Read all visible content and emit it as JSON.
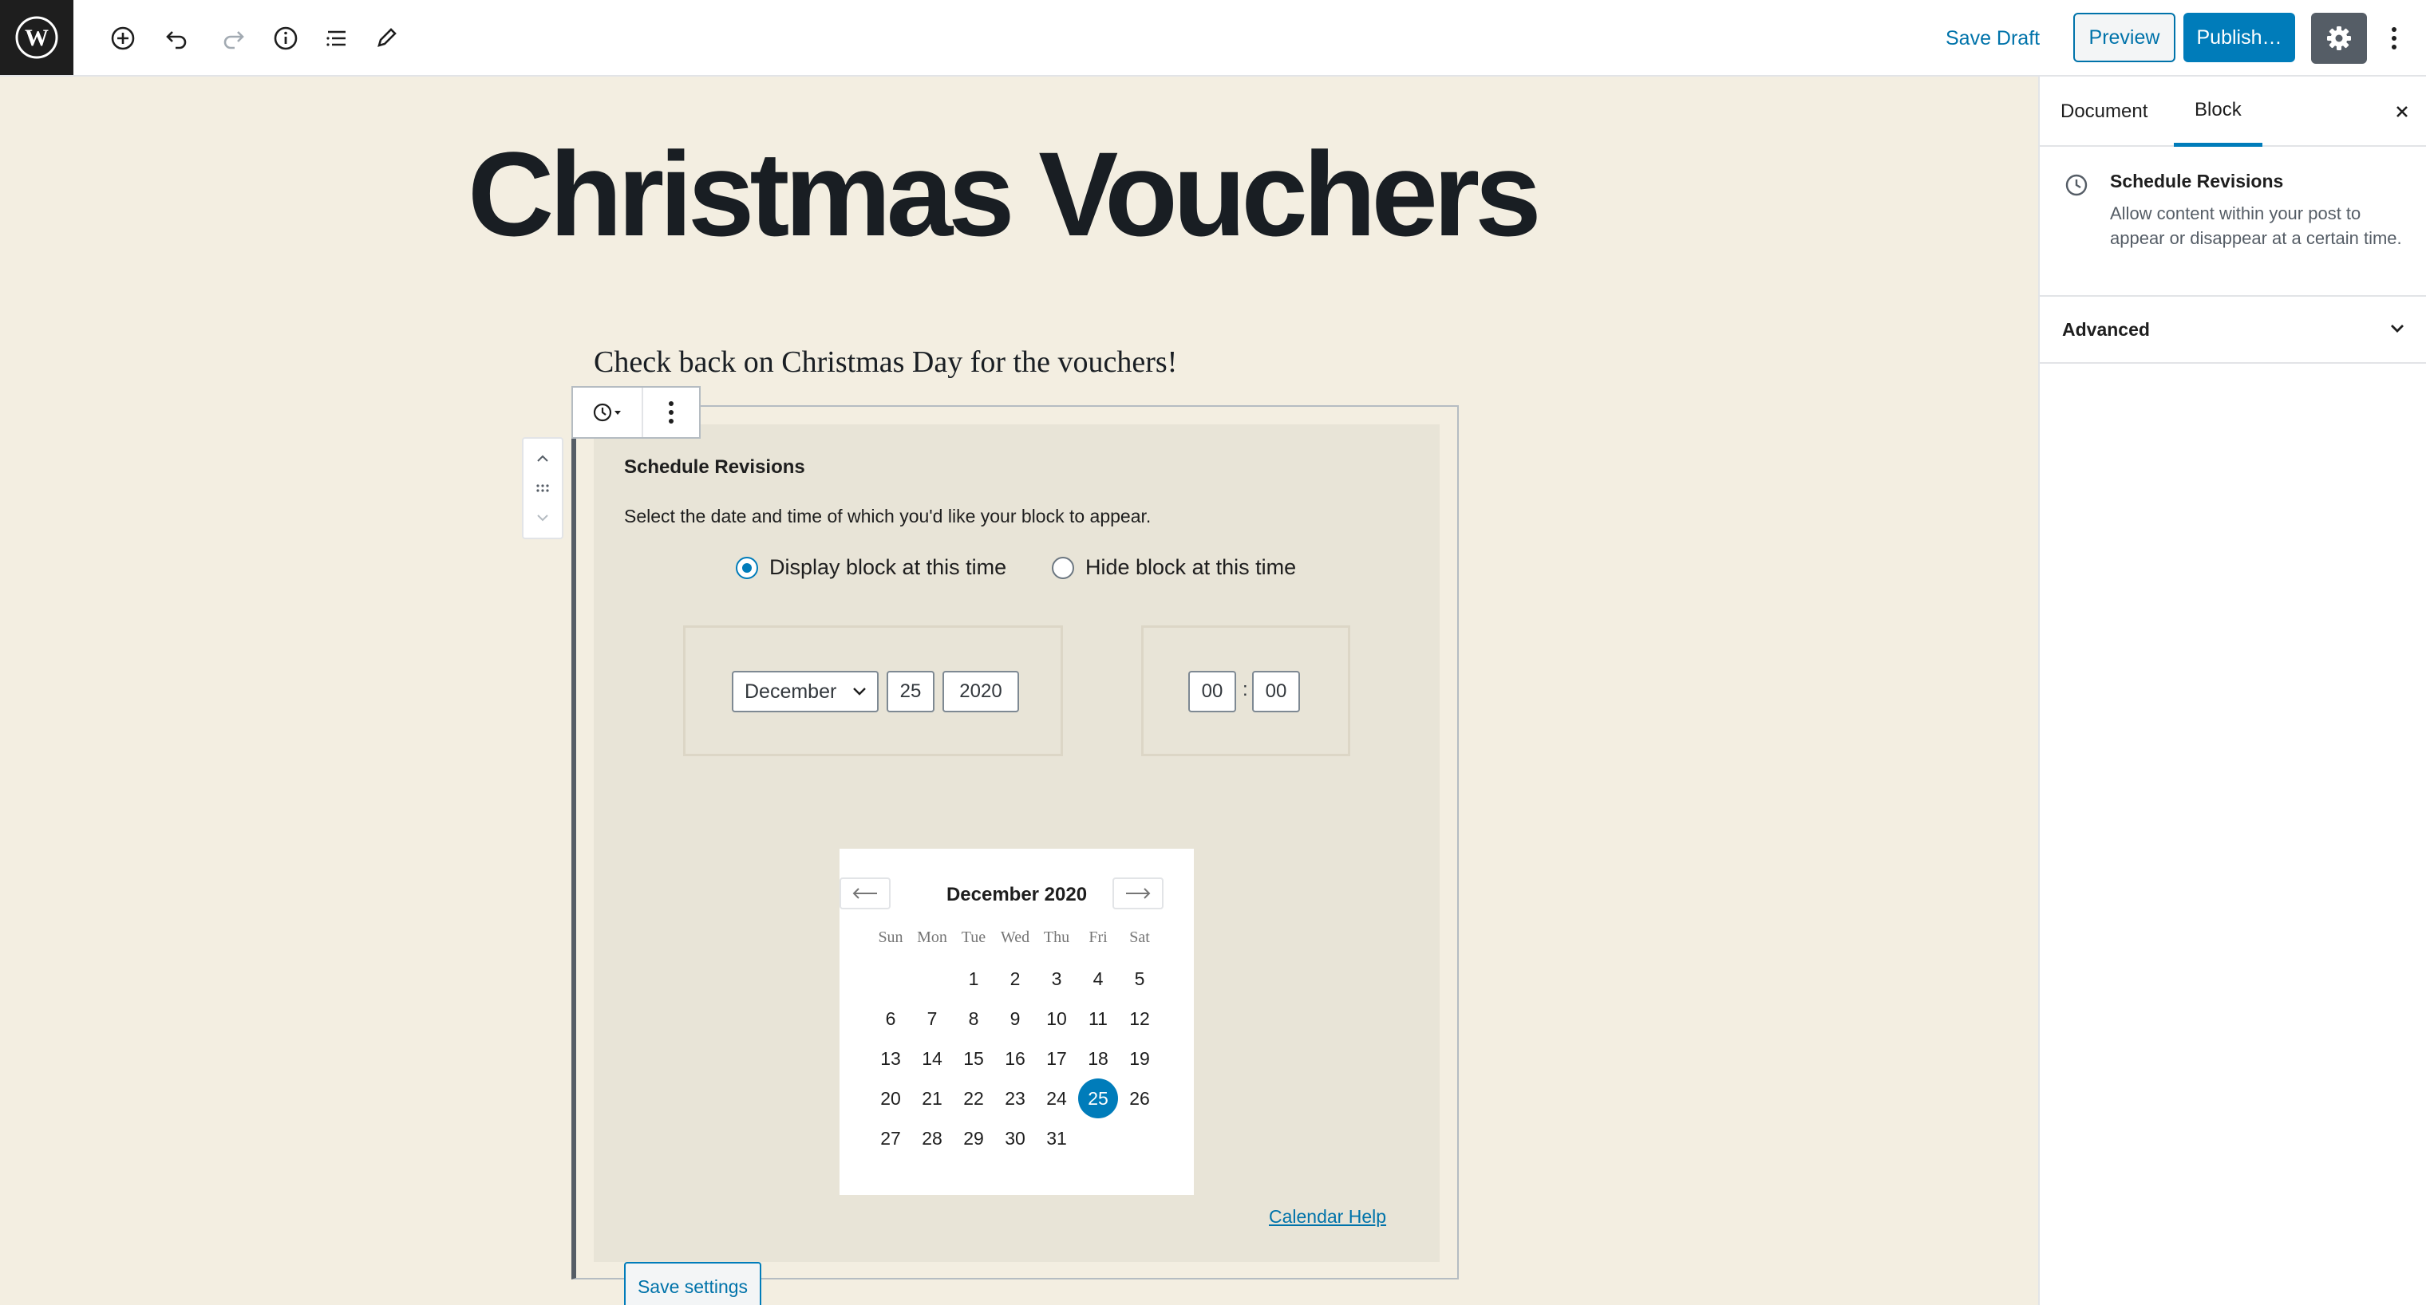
{
  "toolbar": {
    "save_draft": "Save Draft",
    "preview": "Preview",
    "publish": "Publish…",
    "icons": [
      "wordpress-logo-icon",
      "add-block-icon",
      "undo-icon",
      "redo-icon",
      "info-icon",
      "block-navigation-icon",
      "edit-mode-icon",
      "settings-gear-icon",
      "more-options-icon"
    ]
  },
  "post": {
    "title": "Christmas Vouchers",
    "paragraph": "Check back on Christmas Day for the vouchers!"
  },
  "block": {
    "title": "Schedule Revisions",
    "description": "Select the date and time of which you'd like your block to appear.",
    "radio_display": "Display block at this time",
    "radio_hide": "Hide block at this time",
    "selected_option": "display",
    "month": "December",
    "day": "25",
    "year": "2020",
    "hour": "00",
    "minute": "00",
    "time_separator": ":",
    "calendar_help": "Calendar Help",
    "save_settings": "Save settings"
  },
  "calendar": {
    "month_label": "December 2020",
    "weekdays": [
      "Sun",
      "Mon",
      "Tue",
      "Wed",
      "Thu",
      "Fri",
      "Sat"
    ],
    "first_weekday_index": 2,
    "days_in_month": 31,
    "selected_day": 25
  },
  "sidebar": {
    "tab_document": "Document",
    "tab_block": "Block",
    "active_tab": "Block",
    "block_name": "Schedule Revisions",
    "block_description": "Allow content within your post to appear or disappear at a certain time.",
    "advanced": "Advanced"
  },
  "colors": {
    "accent": "#007cba",
    "link": "#0073aa",
    "canvas": "#f3eee1",
    "panel": "#e8e4d7"
  }
}
